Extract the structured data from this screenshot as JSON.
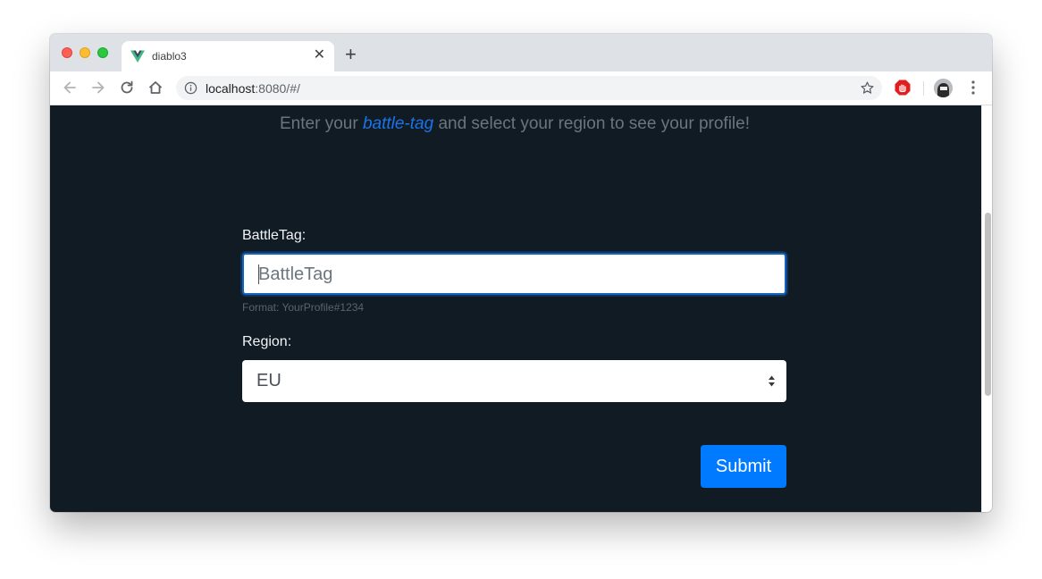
{
  "browser": {
    "tab": {
      "title": "diablo3",
      "favicon": "vue-logo-icon",
      "close_label": "✕"
    },
    "new_tab_label": "+",
    "url": {
      "host": "localhost",
      "path": ":8080/#/"
    },
    "colors": {
      "vue_green": "#41b883",
      "vue_dark": "#35495e"
    }
  },
  "page": {
    "subtitle": {
      "before": "Enter your ",
      "highlight": "battle-tag",
      "after": " and select your region to see your profile!"
    },
    "form": {
      "battletag_label": "BattleTag:",
      "battletag_value": "",
      "battletag_placeholder": "BattleTag",
      "battletag_help": "Format: YourProfile#1234",
      "region_label": "Region:",
      "region_selected": "EU",
      "submit_label": "Submit"
    },
    "colors": {
      "background": "#111b24",
      "accent": "#007bff",
      "link": "#1a73e8"
    }
  }
}
